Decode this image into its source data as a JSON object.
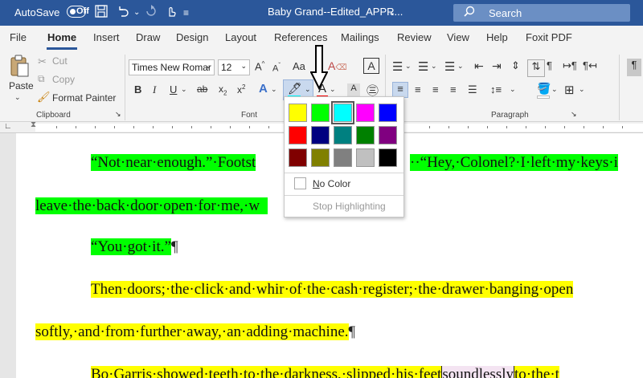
{
  "titlebar": {
    "autosave_label": "AutoSave",
    "autosave_state": "Off",
    "document_title": "Baby Grand--Edited_APPR...",
    "dropdown_glyph": "⌄",
    "search_placeholder": "Search"
  },
  "tabs": [
    {
      "label": "File"
    },
    {
      "label": "Home"
    },
    {
      "label": "Insert"
    },
    {
      "label": "Draw"
    },
    {
      "label": "Design"
    },
    {
      "label": "Layout"
    },
    {
      "label": "References"
    },
    {
      "label": "Mailings"
    },
    {
      "label": "Review"
    },
    {
      "label": "View"
    },
    {
      "label": "Help"
    },
    {
      "label": "Foxit PDF"
    }
  ],
  "clipboard": {
    "paste": "Paste",
    "cut": "Cut",
    "copy": "Copy",
    "format_painter": "Format Painter",
    "group_label": "Clipboard"
  },
  "font": {
    "name": "Times New Romar",
    "size": "12",
    "group_label": "Font"
  },
  "paragraph": {
    "group_label": "Paragraph"
  },
  "highlight_menu": {
    "colors": [
      "#ffff00",
      "#00ff00",
      "#00ffff",
      "#ff00ff",
      "#0000ff",
      "#ff0000",
      "#000080",
      "#008080",
      "#008000",
      "#800080",
      "#800000",
      "#808000",
      "#808080",
      "#c0c0c0",
      "#000000"
    ],
    "selected_index": 2,
    "no_color": "No Color",
    "stop_highlighting": "Stop Highlighting"
  },
  "document": {
    "p1": "“Not·near·enough.”·Footst",
    "p1_tail": "··“Hey,·Colonel?·I·left·my·keys·i",
    "p2": "leave·the·back·door·open·for·me,·w",
    "p3": "“You·got·it.”",
    "p4": "Then·doors;·the·click·and·whir·of·the·cash·register;·the·drawer·banging·open",
    "p5": "softly,·and·from·further·away,·an·adding·machine.",
    "p6a": "Bo·Garris·showed·teeth·to·the·darkness,·slipped·his·feet",
    "p6b": "soundlessly",
    "p6c": "to·the·t",
    "pilcrow": "¶"
  },
  "colors": {
    "titlebar": "#2b579a",
    "highlight_green": "#00ff00",
    "highlight_yellow": "#ffff00"
  }
}
